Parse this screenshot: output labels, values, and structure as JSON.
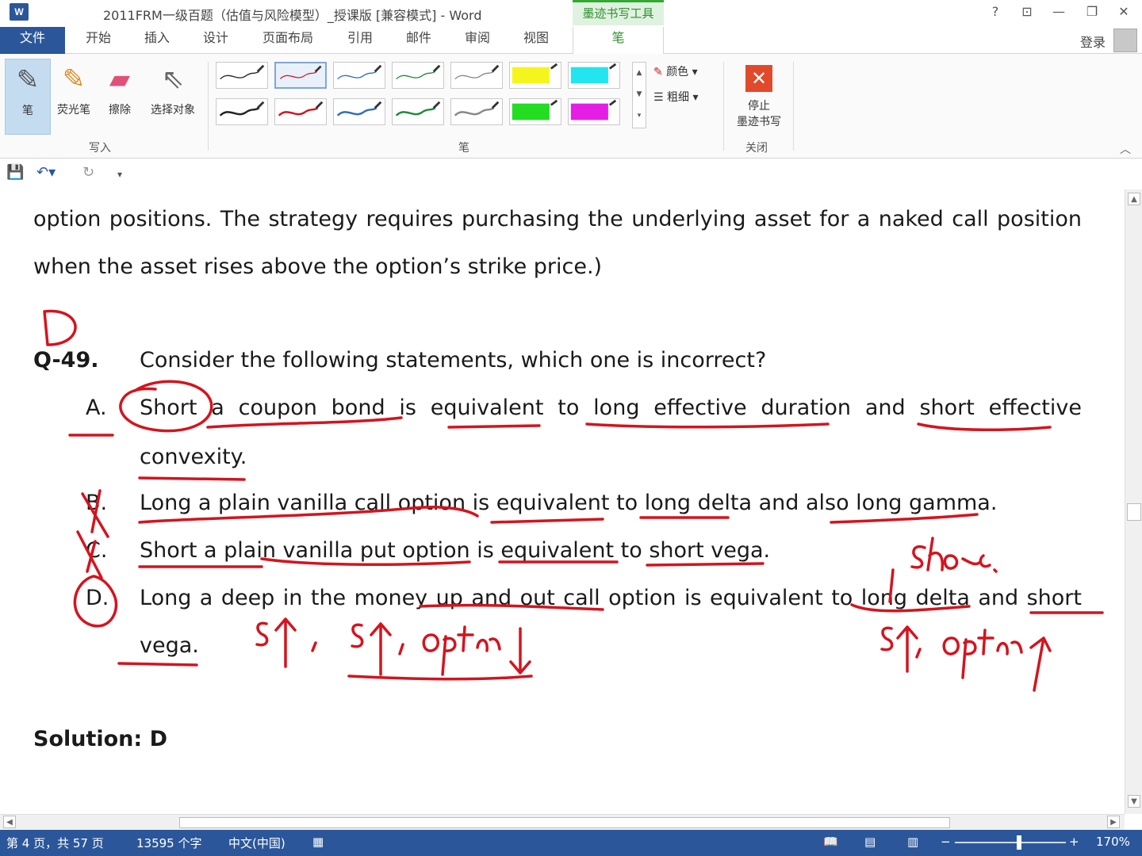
{
  "window": {
    "title": "2011FRM一级百题（估值与风险模型）_授课版 [兼容模式] - Word",
    "context_tab": "墨迹书写工具",
    "help": "?",
    "login": "登录"
  },
  "tabs": [
    "文件",
    "开始",
    "插入",
    "设计",
    "页面布局",
    "引用",
    "邮件",
    "审阅",
    "视图",
    "笔"
  ],
  "ribbon": {
    "write_group": {
      "label": "写入",
      "buttons": [
        "笔",
        "荧光笔",
        "擦除",
        "选择对象"
      ]
    },
    "pen_group": {
      "label": "笔",
      "color": "颜色",
      "thickness": "粗细"
    },
    "close_group": {
      "label": "关闭",
      "stop_line1": "停止",
      "stop_line2": "墨迹书写"
    }
  },
  "document": {
    "line1": "option positions. The strategy requires purchasing the underlying asset for a naked call position",
    "line2": "when the asset rises above the option’s strike price.)",
    "question_number": "Q-49.",
    "question_text": "Consider the following statements, which one is incorrect?",
    "options": [
      {
        "letter": "A.",
        "text1": "Short a coupon bond is equivalent to long effective duration and short effective",
        "text2": "convexity."
      },
      {
        "letter": "B.",
        "text1": "Long a plain vanilla call option is equivalent to long delta and also long gamma."
      },
      {
        "letter": "C.",
        "text1": "Short a plain vanilla put option is equivalent to short vega."
      },
      {
        "letter": "D.",
        "text1": "Long a deep in the money up and out call option is equivalent to long delta and short",
        "text2": "vega."
      }
    ],
    "solution": "Solution: D",
    "ink_color": "#d4141e"
  },
  "status": {
    "page": "第 4 页，共 57 页",
    "words": "13595 个字",
    "language": "中文(中国)",
    "zoom": "170%"
  }
}
